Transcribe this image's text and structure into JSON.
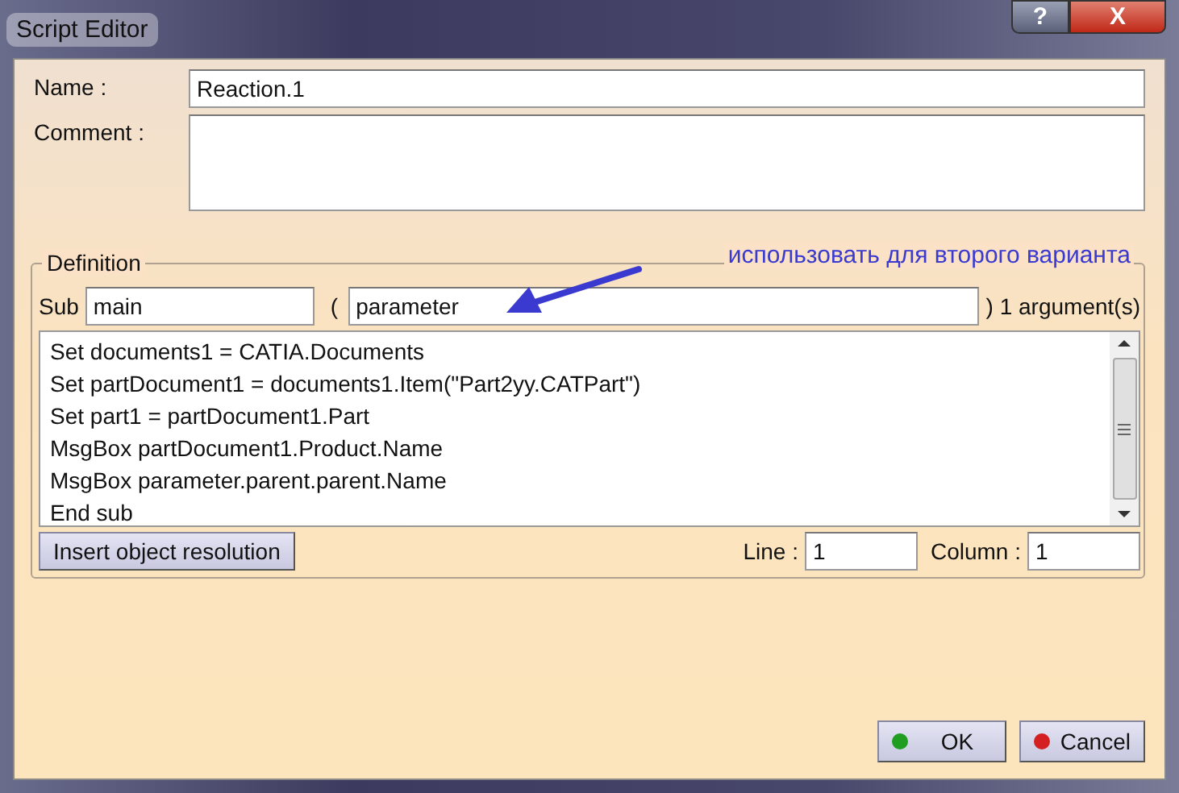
{
  "window": {
    "title": "Script Editor",
    "help_button": "?",
    "close_button": "X"
  },
  "name_field": {
    "label": "Name :",
    "value": "Reaction.1"
  },
  "comment_field": {
    "label": "Comment :"
  },
  "definition": {
    "title": "Definition",
    "annotation": "использовать для второго варианта",
    "sub_label": "Sub",
    "sub_value": "main",
    "open_paren": "(",
    "parameter_value": "parameter",
    "argument_count": ") 1 argument(s)",
    "code_lines": [
      "Set documents1 = CATIA.Documents",
      "Set partDocument1 = documents1.Item(\"Part2yy.CATPart\")",
      "Set part1 = partDocument1.Part",
      "MsgBox partDocument1.Product.Name",
      "MsgBox parameter.parent.parent.Name",
      "End sub"
    ],
    "insert_button": "Insert object resolution",
    "line_label": "Line :",
    "line_value": "1",
    "column_label": "Column :",
    "column_value": "1"
  },
  "buttons": [
    {
      "label": "OK",
      "color": "#1f9e1f"
    },
    {
      "label": "Cancel",
      "color": "#d42020"
    }
  ]
}
